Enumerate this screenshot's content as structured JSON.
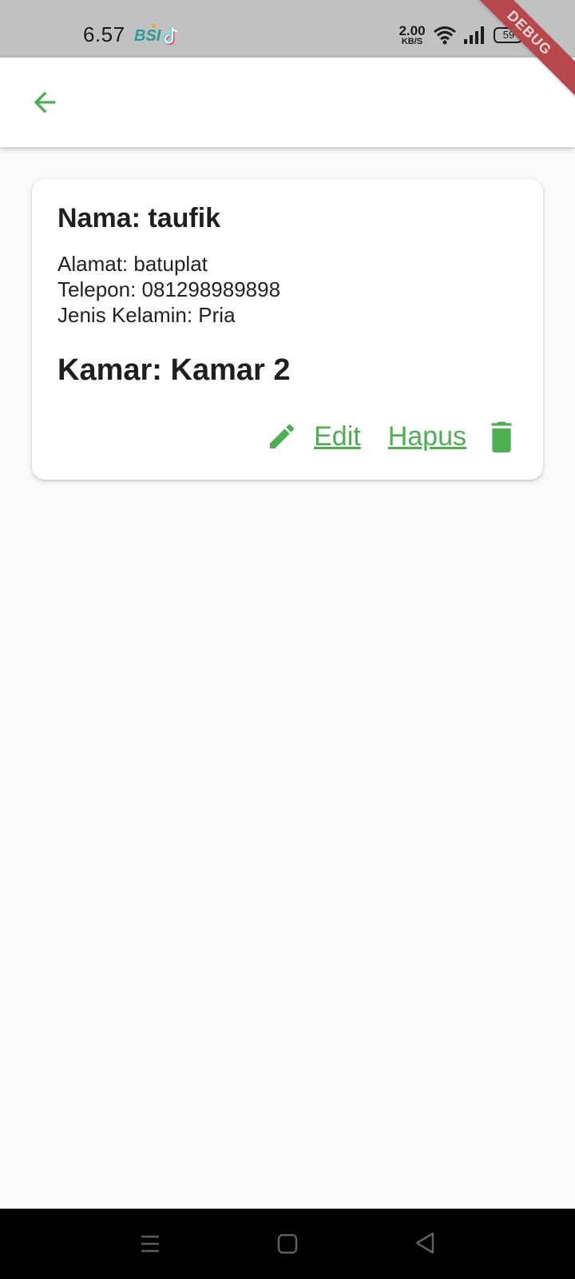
{
  "status_bar": {
    "time": "6.57",
    "app_icons": [
      "bsi-icon",
      "tiktok-icon"
    ],
    "bsi_label": "BSI",
    "net_speed_value": "2.00",
    "net_speed_unit": "KB/S",
    "battery_level": "59",
    "indicators": [
      "wifi-icon",
      "signal-icon",
      "battery-icon",
      "charging-icon"
    ]
  },
  "debug_banner": "DEBUG",
  "app_bar": {
    "back_icon": "arrow-left-icon"
  },
  "card": {
    "name": "Nama: taufik",
    "address": "Alamat: batuplat",
    "phone": "Telepon: 081298989898",
    "gender": "Jenis Kelamin: Pria",
    "room": "Kamar: Kamar 2",
    "edit_label": "Edit",
    "delete_label": "Hapus"
  },
  "nav_bar": {
    "buttons": [
      "menu-icon",
      "home-icon",
      "back-triangle-icon"
    ]
  },
  "colors": {
    "accent": "#4caf50",
    "status_bar_bg": "#c1c1c1",
    "page_bg": "#fafafa",
    "debug_banner": "#b8474c",
    "nav_bar_bg": "#000000"
  }
}
